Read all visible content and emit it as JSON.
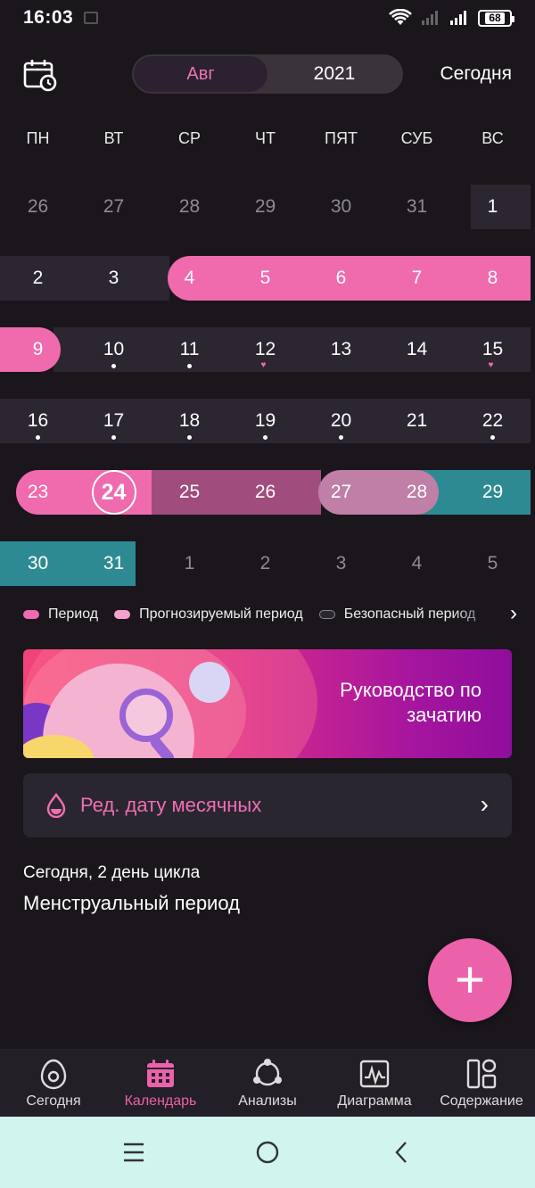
{
  "status_bar": {
    "time": "16:03",
    "battery": "68"
  },
  "header": {
    "month": "Авг",
    "year": "2021",
    "today_button": "Сегодня"
  },
  "weekdays": [
    "ПН",
    "ВТ",
    "СР",
    "ЧТ",
    "ПЯТ",
    "СУБ",
    "ВС"
  ],
  "calendar": {
    "rows": [
      [
        {
          "d": "26",
          "dim": true
        },
        {
          "d": "27",
          "dim": true
        },
        {
          "d": "28",
          "dim": true
        },
        {
          "d": "29",
          "dim": true
        },
        {
          "d": "30",
          "dim": true
        },
        {
          "d": "31",
          "dim": true
        },
        {
          "d": "1"
        }
      ],
      [
        {
          "d": "2"
        },
        {
          "d": "3"
        },
        {
          "d": "4"
        },
        {
          "d": "5"
        },
        {
          "d": "6"
        },
        {
          "d": "7"
        },
        {
          "d": "8"
        }
      ],
      [
        {
          "d": "9"
        },
        {
          "d": "10",
          "mark": "dot"
        },
        {
          "d": "11",
          "mark": "dot"
        },
        {
          "d": "12",
          "mark": "heart"
        },
        {
          "d": "13"
        },
        {
          "d": "14"
        },
        {
          "d": "15",
          "mark": "heart"
        }
      ],
      [
        {
          "d": "16",
          "mark": "dot"
        },
        {
          "d": "17",
          "mark": "dot"
        },
        {
          "d": "18",
          "mark": "dot"
        },
        {
          "d": "19",
          "mark": "dot"
        },
        {
          "d": "20",
          "mark": "dot"
        },
        {
          "d": "21"
        },
        {
          "d": "22",
          "mark": "dot"
        }
      ],
      [
        {
          "d": "23"
        },
        {
          "d": "24",
          "today": true
        },
        {
          "d": "25"
        },
        {
          "d": "26"
        },
        {
          "d": "27"
        },
        {
          "d": "28"
        },
        {
          "d": "29"
        }
      ],
      [
        {
          "d": "30"
        },
        {
          "d": "31"
        },
        {
          "d": "1",
          "dim": true
        },
        {
          "d": "2",
          "dim": true
        },
        {
          "d": "3",
          "dim": true
        },
        {
          "d": "4",
          "dim": true
        },
        {
          "d": "5",
          "dim": true
        }
      ]
    ]
  },
  "legend": {
    "period": "Период",
    "predicted": "Прогнозируемый период",
    "safe": "Безопасный период"
  },
  "banner": {
    "title": "Руководство по зачатию"
  },
  "edit_period": {
    "label": "Ред. дату месячных"
  },
  "cycle": {
    "subtitle": "Сегодня, 2 день цикла",
    "title": "Менструальный период"
  },
  "tabs": [
    {
      "label": "Сегодня",
      "icon": "egg-icon"
    },
    {
      "label": "Календарь",
      "icon": "calendar-icon",
      "active": true
    },
    {
      "label": "Анализы",
      "icon": "analysis-icon"
    },
    {
      "label": "Диаграмма",
      "icon": "chart-icon"
    },
    {
      "label": "Содержание",
      "icon": "content-icon"
    }
  ],
  "colors": {
    "accent": "#ec62aa",
    "period": "#f06aae",
    "predicted": "#a04c7c",
    "safe": "#2e8a92",
    "background": "#1a161c"
  }
}
